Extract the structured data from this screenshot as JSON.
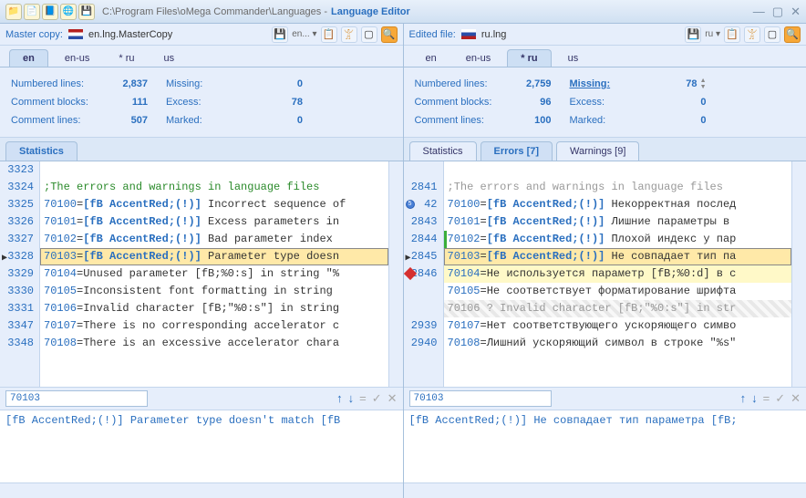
{
  "title": {
    "path": "C:\\Program Files\\oMega Commander\\Languages - ",
    "app": "Language Editor"
  },
  "left": {
    "header_label": "Master copy:",
    "filename": "en.lng.MasterCopy",
    "drop_label": "en...",
    "file_tabs": [
      "en",
      "en-us",
      "* ru",
      "us"
    ],
    "active_file_tab": 0,
    "stats": {
      "numbered_lines_label": "Numbered lines:",
      "numbered_lines": "2,837",
      "missing_label": "Missing:",
      "missing": "0",
      "comment_blocks_label": "Comment blocks:",
      "comment_blocks": "111",
      "excess_label": "Excess:",
      "excess": "78",
      "comment_lines_label": "Comment lines:",
      "comment_lines": "507",
      "marked_label": "Marked:",
      "marked": "0"
    },
    "sub_tabs": [
      "Statistics"
    ],
    "lines": [
      {
        "ln": "3323",
        "type": "blank"
      },
      {
        "ln": "3324",
        "type": "comment",
        "text": ";The errors and warnings in language files"
      },
      {
        "ln": "3325",
        "num": "70100",
        "attr": "[fB AccentRed;(!)]",
        "text": " Incorrect sequence of"
      },
      {
        "ln": "3326",
        "num": "70101",
        "attr": "[fB AccentRed;(!)]",
        "text": " Excess parameters in"
      },
      {
        "ln": "3327",
        "num": "70102",
        "attr": "[fB AccentRed;(!)]",
        "text": " Bad parameter index"
      },
      {
        "ln": "3328",
        "num": "70103",
        "attr": "[fB AccentRed;(!)]",
        "text": " Parameter type doesn",
        "selected": true,
        "arrow": true
      },
      {
        "ln": "3329",
        "num": "70104",
        "text": "Unused parameter [fB;%0:s] in string \"%"
      },
      {
        "ln": "3330",
        "num": "70105",
        "text": "Inconsistent font formatting in string"
      },
      {
        "ln": "3331",
        "num": "70106",
        "text": "Invalid character [fB;\"%0:s\"] in string"
      },
      {
        "ln": "3347",
        "num": "70107",
        "text": "There is no corresponding accelerator c"
      },
      {
        "ln": "3348",
        "num": "70108",
        "text": "There is an excessive accelerator chara"
      }
    ],
    "edit_id": "70103",
    "edit_text": "[fB AccentRed;(!)] Parameter type doesn't match [fB"
  },
  "right": {
    "header_label": "Edited file:",
    "filename": "ru.lng",
    "drop_label": "ru",
    "file_tabs": [
      "en",
      "en-us",
      "* ru",
      "us"
    ],
    "active_file_tab": 2,
    "stats": {
      "numbered_lines_label": "Numbered lines:",
      "numbered_lines": "2,759",
      "missing_label": "Missing:",
      "missing": "78",
      "comment_blocks_label": "Comment blocks:",
      "comment_blocks": "96",
      "excess_label": "Excess:",
      "excess": "0",
      "comment_lines_label": "Comment lines:",
      "comment_lines": "100",
      "marked_label": "Marked:",
      "marked": "0"
    },
    "sub_tabs": [
      "Statistics",
      "Errors [7]",
      "Warnings [9]"
    ],
    "active_sub_tab": 1,
    "lines": [
      {
        "ln": "",
        "type": "blank"
      },
      {
        "ln": "2841",
        "type": "comment-gray",
        "text": ";The errors and warnings in language files"
      },
      {
        "ln": "42",
        "num": "70100",
        "attr": "[fB AccentRed;(!)]",
        "text": " Некорректная послед",
        "badge": "5"
      },
      {
        "ln": "2843",
        "num": "70101",
        "attr": "[fB AccentRed;(!)]",
        "text": " Лишние параметры в "
      },
      {
        "ln": "2844",
        "num": "70102",
        "attr": "[fB AccentRed;(!)]",
        "text": " Плохой индекс у пар",
        "greenbar": true
      },
      {
        "ln": "2845",
        "num": "70103",
        "attr": "[fB AccentRed;(!)]",
        "text": " Не совпадает тип па",
        "selected": true,
        "arrow": true
      },
      {
        "ln": "2846",
        "num": "70104",
        "text": "Не используется параметр [fB;%0:d] в с",
        "yellow": true,
        "diamond": true
      },
      {
        "ln": "",
        "num": "70105",
        "text": "Не соответствует форматирование шрифта"
      },
      {
        "ln": "",
        "type": "grey",
        "num": "70106",
        "text": " ? Invalid character [fB;\"%0:s\"] in str",
        "hatched": true
      },
      {
        "ln": "2939",
        "num": "70107",
        "text": "Нет соответствующего ускоряющего симво"
      },
      {
        "ln": "2940",
        "num": "70108",
        "text": "Лишний ускоряющий символ в строке \"%s\""
      }
    ],
    "edit_id": "70103",
    "edit_text": "[fB AccentRed;(!)] Не совпадает тип параметра [fB;"
  }
}
